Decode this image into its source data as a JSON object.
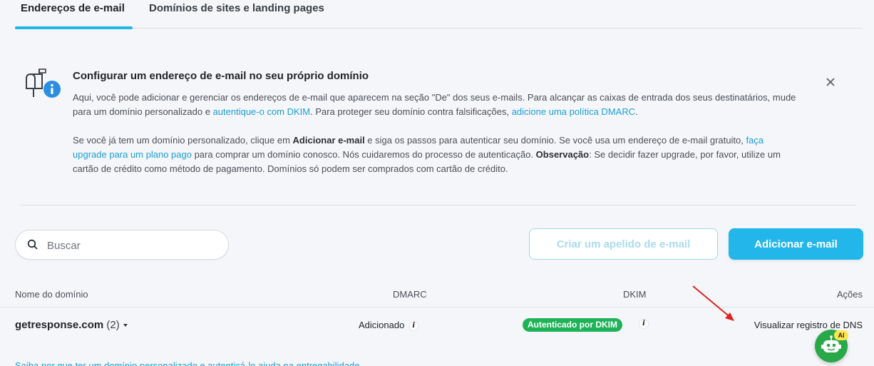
{
  "tabs": [
    {
      "label": "Endereços de e-mail",
      "active": true
    },
    {
      "label": "Domínios de sites e landing pages",
      "active": false
    }
  ],
  "info": {
    "title": "Configurar um endereço de e-mail no seu próprio domínio",
    "p1_a": "Aqui, você pode adicionar e gerenciar os endereços de e-mail que aparecem na seção \"De\" dos seus e-mails. Para alcançar as caixas de entrada dos seus destinatários, mude para um domínio personalizado e ",
    "p1_link1": "autentique-o com DKIM",
    "p1_b": ". Para proteger seu domínio contra falsificações, ",
    "p1_link2": "adicione uma política DMARC",
    "p1_c": ".",
    "p2_a": "Se você já tem um domínio personalizado, clique em ",
    "p2_bold1": "Adicionar e-mail",
    "p2_b": " e siga os passos para autenticar seu domínio. Se você usa um endereço de e-mail gratuito, ",
    "p2_link": "faça upgrade para um plano pago",
    "p2_c": " para comprar um domínio conosco. Nós cuidaremos do processo de autenticação. ",
    "p2_bold2": "Observação",
    "p2_d": ": Se decidir fazer upgrade, por favor, utilize um cartão de crédito como método de pagamento. Domínios só podem ser comprados com cartão de crédito."
  },
  "search": {
    "placeholder": "Buscar"
  },
  "buttons": {
    "alias": "Criar um apelido de e-mail",
    "add_email": "Adicionar e-mail"
  },
  "table": {
    "headers": {
      "domain": "Nome do domínio",
      "dmarc": "DMARC",
      "dkim": "DKIM",
      "actions": "Ações"
    },
    "rows": [
      {
        "domain": "getresponse.com",
        "count": "(2)",
        "dmarc": "Adicionado",
        "dkim": "Autenticado por DKIM",
        "action": "Visualizar registro de DNS"
      }
    ]
  },
  "assistant": {
    "badge": "AI"
  },
  "bottom_link": "Saiba por que ter um domínio personalizado e autenticá-lo ajuda na entregabilidade",
  "colors": {
    "accent": "#23b6ea",
    "success": "#1fb358",
    "arrow": "#e0201b",
    "bot": "#29a84a"
  }
}
